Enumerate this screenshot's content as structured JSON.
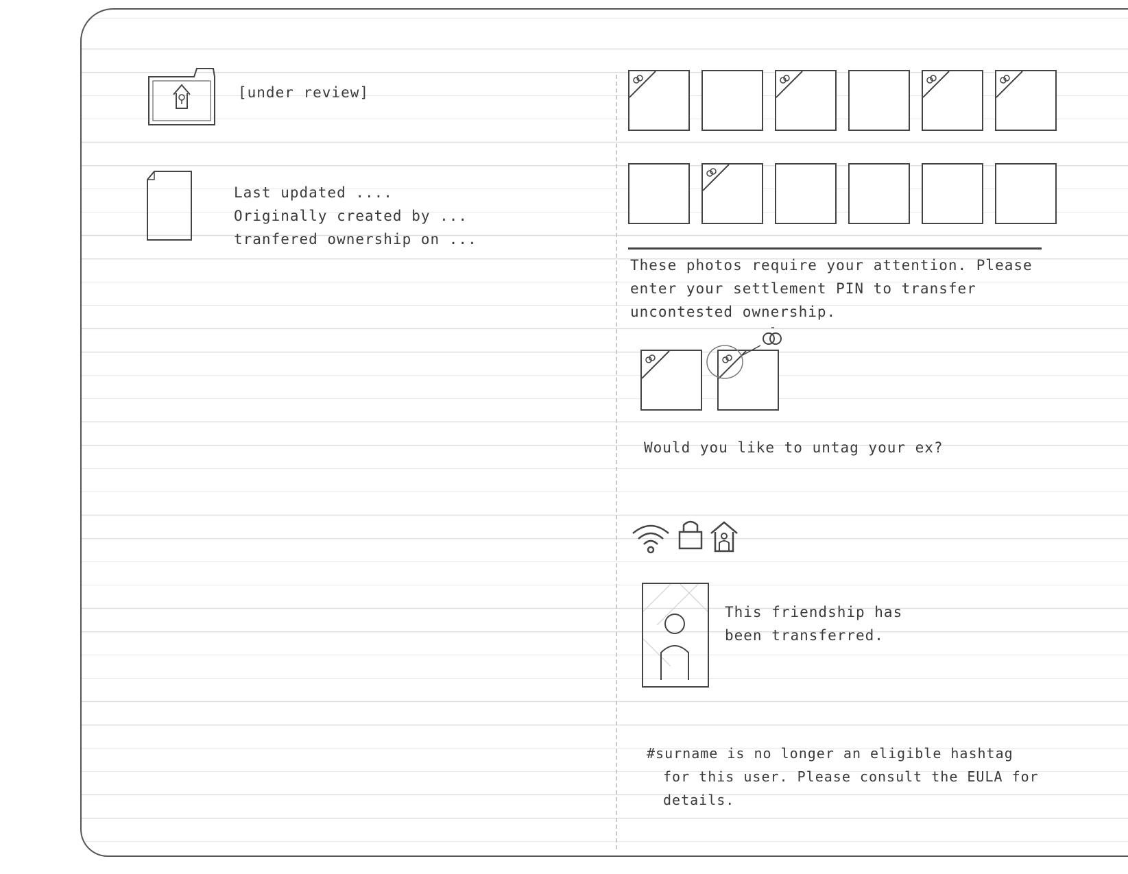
{
  "folder": {
    "icon": "folder-home-lock-icon",
    "status": "[under review]"
  },
  "document": {
    "icon": "document-icon",
    "lines": [
      "Last updated ....",
      "Originally created by ...",
      "tranfered ownership on ..."
    ]
  },
  "photos": {
    "row1": [
      {
        "tagged": true
      },
      {
        "tagged": false
      },
      {
        "tagged": true
      },
      {
        "tagged": false
      },
      {
        "tagged": true
      },
      {
        "tagged": true
      }
    ],
    "row2": [
      {
        "tagged": false
      },
      {
        "tagged": true
      },
      {
        "tagged": false
      },
      {
        "tagged": false
      },
      {
        "tagged": false
      },
      {
        "tagged": false
      }
    ],
    "tag_icon": "rings-icon"
  },
  "notice": {
    "line1": "These photos require your attention. Please",
    "line2": "enter your settlement PIN to transfer",
    "line3": "uncontested ownership."
  },
  "untag": {
    "question": "Would you like to untag your ex?",
    "icon": "rings-icon"
  },
  "status_icons": [
    "wifi-icon",
    "lock-icon",
    "home-person-icon"
  ],
  "friendship": {
    "icon": "person-icon",
    "line1": "This friendship has",
    "line2": "been transferred."
  },
  "hashtag": {
    "line1": "#surname is no longer an eligible hashtag",
    "line2": "for this user. Please consult the EULA for",
    "line3": "details."
  }
}
